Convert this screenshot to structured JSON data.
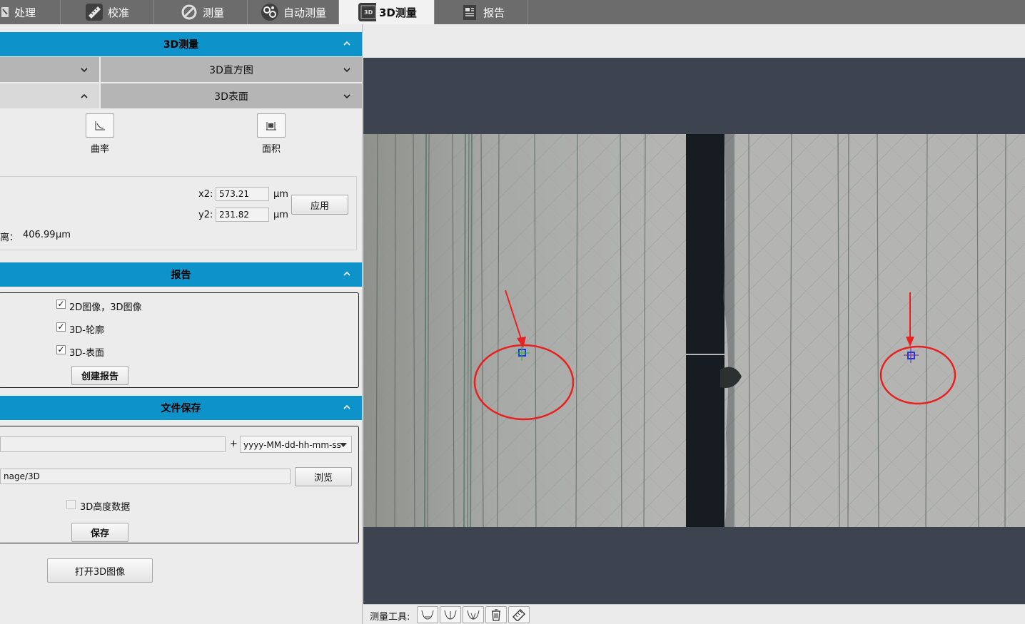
{
  "tabs": [
    {
      "label": "处理",
      "icon": "process-icon",
      "active": false
    },
    {
      "label": "校准",
      "icon": "ruler-icon",
      "active": false
    },
    {
      "label": "测量",
      "icon": "measure-icon",
      "active": false
    },
    {
      "label": "自动测量",
      "icon": "gears-icon",
      "active": false
    },
    {
      "label": "3D测量",
      "icon": "3d-icon",
      "active": true
    },
    {
      "label": "报告",
      "icon": "report-icon",
      "active": false
    }
  ],
  "measure3d": {
    "header": "3D测量",
    "row1_right": "3D直方图",
    "row2_right": "3D表面",
    "curvature_label": "曲率",
    "area_label": "面积",
    "x2_label": "x2:",
    "x2_value": "573.21",
    "y2_label": "y2:",
    "y2_value": "231.82",
    "unit": "μm",
    "apply_label": "应用",
    "distance_label": "离：",
    "distance_value": "406.99",
    "distance_unit": "μm"
  },
  "report": {
    "header": "报告",
    "options": [
      {
        "label": "2D图像，3D图像",
        "checked": true
      },
      {
        "label": "3D-轮廓",
        "checked": true
      },
      {
        "label": "3D-表面",
        "checked": true
      }
    ],
    "create_label": "创建报告"
  },
  "filesave": {
    "header": "文件保存",
    "plus": "+",
    "date_format": "yyyy-MM-dd-hh-mm-ss",
    "path_value": "nage/3D",
    "browse_label": "浏览",
    "height_data_label": "3D高度数据",
    "height_data_checked": false,
    "save_label": "保存"
  },
  "open3d_label": "打开3D图像",
  "toolbar": {
    "label": "测量工具:",
    "tools": [
      "curve-tool-1-icon",
      "curve-tool-2-icon",
      "curve-tool-3-icon",
      "trash-icon",
      "ruler-tool-icon"
    ]
  },
  "colors": {
    "accent": "#0d93c9",
    "tabbar": "#6c6c6c",
    "viewer_bg": "#3e4350",
    "annotation": "#e82020"
  }
}
